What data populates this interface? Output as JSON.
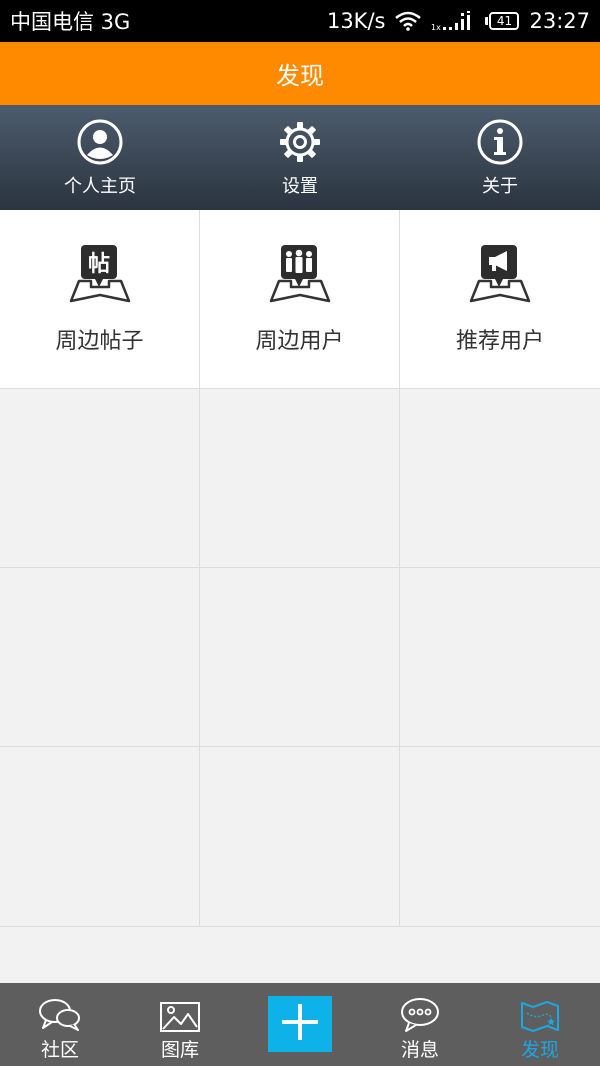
{
  "status_bar": {
    "carrier": "中国电信 3G",
    "speed": "13K/s",
    "battery": "41",
    "time": "23:27",
    "signal_label": "1x"
  },
  "title_bar": {
    "title": "发现"
  },
  "quick_menu": [
    {
      "label": "个人主页",
      "icon": "user-circle-icon"
    },
    {
      "label": "设置",
      "icon": "gear-icon"
    },
    {
      "label": "关于",
      "icon": "info-icon"
    }
  ],
  "grid": [
    {
      "label": "周边帖子",
      "icon": "nearby-posts-icon",
      "glyph": "帖"
    },
    {
      "label": "周边用户",
      "icon": "nearby-users-icon"
    },
    {
      "label": "推荐用户",
      "icon": "recommend-users-icon"
    }
  ],
  "bottom_nav": [
    {
      "label": "社区",
      "icon": "chat-bubbles-icon"
    },
    {
      "label": "图库",
      "icon": "image-gallery-icon"
    },
    {
      "label": "",
      "icon": "plus-icon"
    },
    {
      "label": "消息",
      "icon": "message-bubble-icon"
    },
    {
      "label": "发现",
      "icon": "map-icon",
      "selected": true
    }
  ],
  "colors": {
    "accent": "#ff8a00",
    "selected_tab": "#1ba7e2",
    "plus_button": "#0eb1e8",
    "header_dark": "#2b3440"
  }
}
